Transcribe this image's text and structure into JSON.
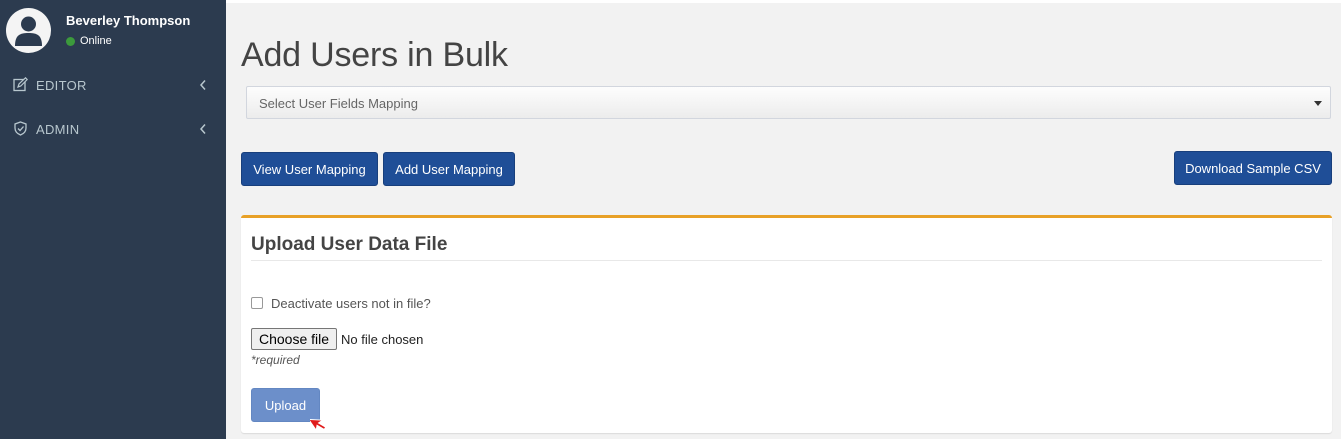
{
  "user": {
    "name": "Beverley Thompson",
    "status": "Online",
    "status_color": "#3c9a3c",
    "avatar_icon": "user-avatar-icon"
  },
  "sidebar": {
    "items": [
      {
        "label": "EDITOR",
        "icon": "edit-icon",
        "chevron": "chevron-left-icon"
      },
      {
        "label": "ADMIN",
        "icon": "shield-icon",
        "chevron": "chevron-left-icon"
      }
    ]
  },
  "page": {
    "title": "Add Users in Bulk"
  },
  "mapping_select": {
    "placeholder": "Select User Fields Mapping"
  },
  "buttons": {
    "view_mapping": "View User Mapping",
    "add_mapping": "Add User Mapping",
    "download_csv": "Download Sample CSV",
    "primary_color": "#1f4e97"
  },
  "upload_box": {
    "title": "Upload User Data File",
    "accent_color": "#e8a127",
    "deactivate_label": "Deactivate users not in file?",
    "deactivate_checked": false,
    "choose_file_label": "Choose file",
    "file_status": "No file chosen",
    "required_note": "*required",
    "upload_label": "Upload"
  }
}
